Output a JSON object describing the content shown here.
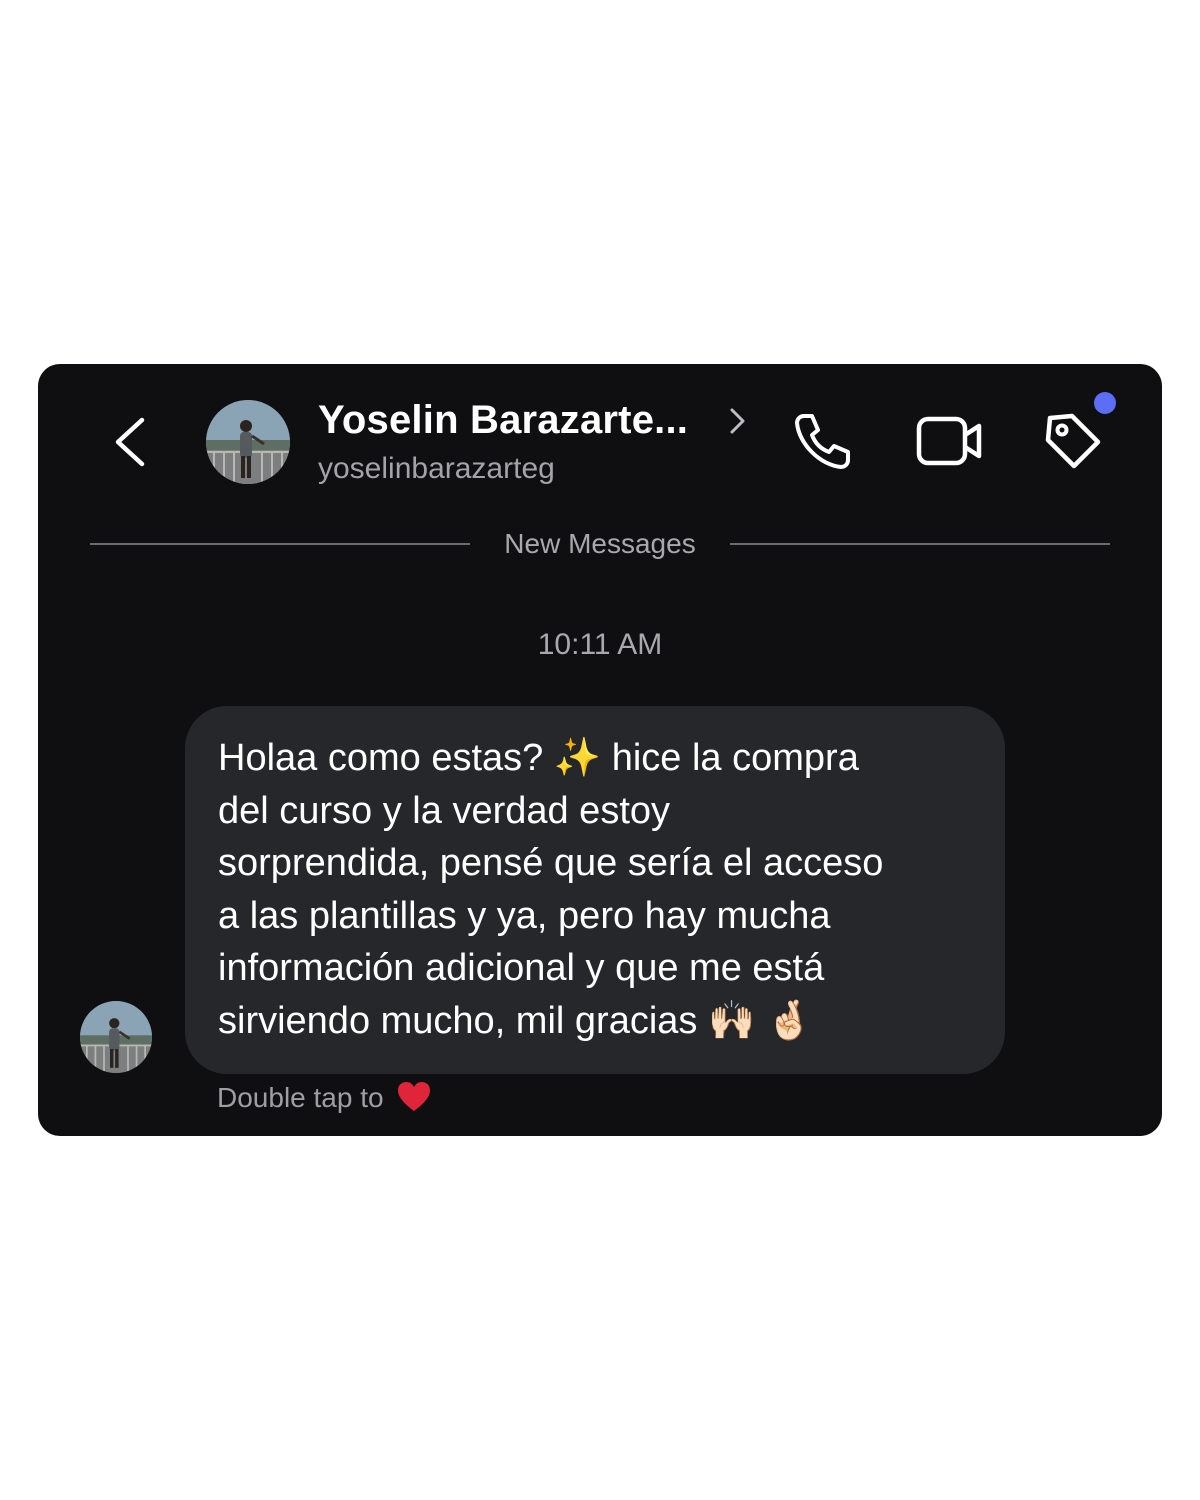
{
  "header": {
    "back_icon": "chevron-left-icon",
    "contact_name": "Yoselin Barazarte...",
    "contact_username": "yoselinbarazarteg",
    "actions": [
      {
        "name": "call",
        "icon": "phone-icon"
      },
      {
        "name": "video-call",
        "icon": "video-camera-icon"
      },
      {
        "name": "tag",
        "icon": "tag-icon",
        "has_notification_dot": true
      }
    ]
  },
  "divider": {
    "label": "New Messages"
  },
  "conversation": {
    "timestamp": "10:11 AM",
    "message": {
      "lines": [
        "Holaa como estas? ✨ hice la compra",
        "del curso y la verdad estoy",
        "sorprendida, pensé que sería el acceso",
        "a las plantillas y ya, pero hay mucha",
        "información adicional y que me está",
        "sirviendo mucho, mil gracias 🙌🏻 🤞🏻"
      ]
    },
    "double_tap_hint": "Double tap to",
    "reaction_icon": "heart-icon"
  },
  "colors": {
    "card_background": "#0f0f12",
    "bubble_background": "#26272b",
    "notification_dot": "#5b6ef5",
    "heart": "#e0243a",
    "secondary_text": "#a3a3a8"
  }
}
